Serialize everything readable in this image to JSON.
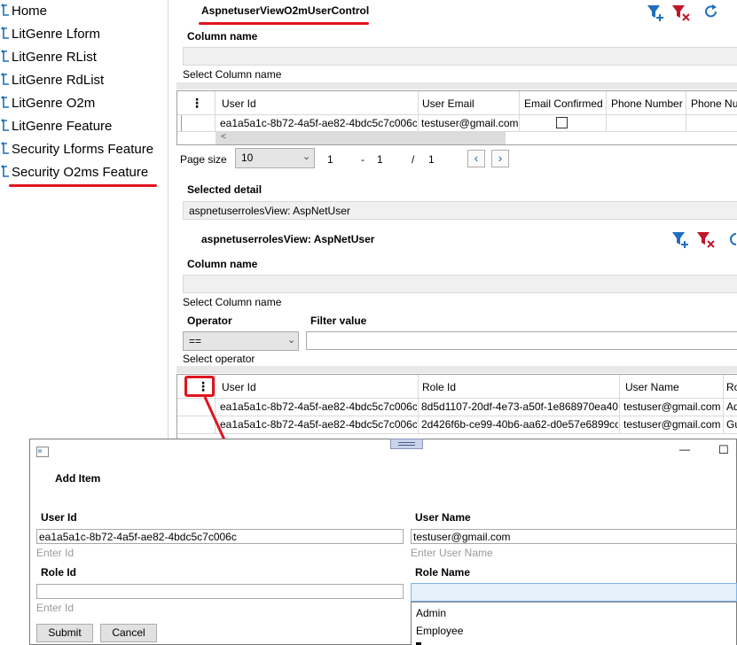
{
  "sidebar": {
    "items": [
      {
        "label": "Home"
      },
      {
        "label": "LitGenre Lform"
      },
      {
        "label": "LitGenre RList"
      },
      {
        "label": "LitGenre RdList"
      },
      {
        "label": "LitGenre O2m"
      },
      {
        "label": "LitGenre Feature"
      },
      {
        "label": "Security Lforms Feature"
      },
      {
        "label": "Security O2ms Feature"
      }
    ]
  },
  "main": {
    "title": "AspnetuserViewO2mUserControl",
    "column_name_label": "Column name",
    "select_column_hint": "Select Column name",
    "grid1": {
      "menu_icon": "⋮",
      "headers": [
        "User Id",
        "User Email",
        "Email Confirmed",
        "Phone Number",
        "Phone Nu"
      ],
      "row": {
        "user_id": "ea1a5a1c-8b72-4a5f-ae82-4bdc5c7c006c",
        "user_email": "testuser@gmail.com"
      }
    },
    "pager": {
      "label": "Page size",
      "size": "10",
      "current": "1",
      "dash": "-",
      "to": "1",
      "slash": "/",
      "total": "1",
      "prev": "‹",
      "next": "›"
    },
    "selected_detail_label": "Selected detail",
    "selected_detail_value": "aspnetuserrolesView: AspNetUser",
    "detail_title": "aspnetuserrolesView: AspNetUser",
    "column_name_label2": "Column name",
    "select_column_hint2": "Select Column name",
    "operator_label": "Operator",
    "filter_value_label": "Filter value",
    "operator_value": "==",
    "select_operator_hint": "Select operator",
    "grid2": {
      "menu_icon": "⋮",
      "headers": [
        "User Id",
        "Role Id",
        "User Name",
        "Ro"
      ],
      "rows": [
        {
          "user_id": "ea1a5a1c-8b72-4a5f-ae82-4bdc5c7c006c",
          "role_id": "8d5d1107-20df-4e73-a50f-1e868970ea40",
          "user_name": "testuser@gmail.com",
          "role": "Ad"
        },
        {
          "user_id": "ea1a5a1c-8b72-4a5f-ae82-4bdc5c7c006c",
          "role_id": "2d426f6b-ce99-40b6-aa62-d0e57e6899cc",
          "user_name": "testuser@gmail.com",
          "role": "Gu"
        }
      ]
    }
  },
  "dialog": {
    "title": "Add Item",
    "minimize": "—",
    "maximize": "☐",
    "user_id_label": "User Id",
    "user_id_value": "ea1a5a1c-8b72-4a5f-ae82-4bdc5c7c006c",
    "user_id_hint": "Enter Id",
    "user_name_label": "User Name",
    "user_name_value": "testuser@gmail.com",
    "user_name_hint": "Enter User Name",
    "role_id_label": "Role Id",
    "role_id_value": "",
    "role_id_hint": "Enter Id",
    "role_name_label": "Role Name",
    "role_options": [
      "Admin",
      "Employee"
    ],
    "submit": "Submit",
    "cancel": "Cancel"
  },
  "colors": {
    "accent": "#0f7fbf",
    "filter_icon": "#1f6fbf",
    "clear_icon": "#c0162a",
    "annotation": "#e0141e"
  }
}
